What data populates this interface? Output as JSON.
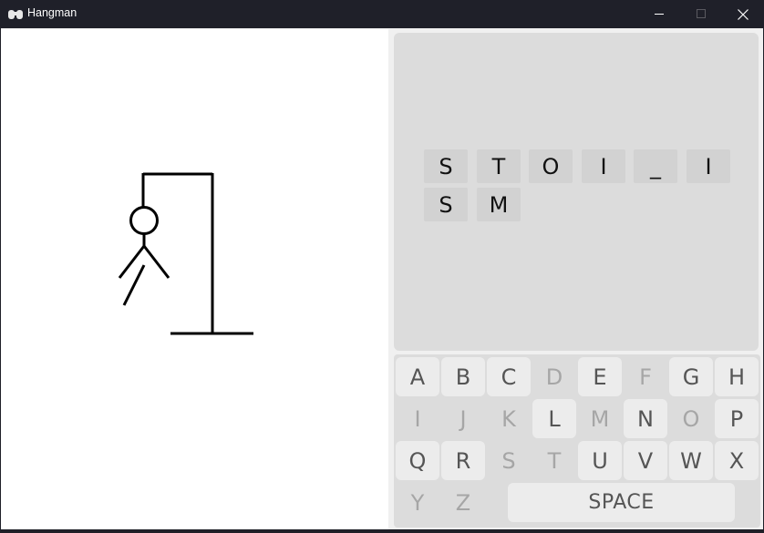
{
  "window": {
    "title": "Hangman",
    "minimize_icon": "minimize-icon",
    "maximize_icon": "maximize-icon",
    "close_icon": "close-icon"
  },
  "word": {
    "tiles": [
      "S",
      "T",
      "O",
      "I",
      "_",
      "I",
      "S",
      "M"
    ]
  },
  "keyboard": {
    "keys": [
      {
        "label": "A",
        "used": false
      },
      {
        "label": "B",
        "used": false
      },
      {
        "label": "C",
        "used": false
      },
      {
        "label": "D",
        "used": true
      },
      {
        "label": "E",
        "used": false
      },
      {
        "label": "F",
        "used": true
      },
      {
        "label": "G",
        "used": false
      },
      {
        "label": "H",
        "used": false
      },
      {
        "label": "I",
        "used": true
      },
      {
        "label": "J",
        "used": true
      },
      {
        "label": "K",
        "used": true
      },
      {
        "label": "L",
        "used": false
      },
      {
        "label": "M",
        "used": true
      },
      {
        "label": "N",
        "used": false
      },
      {
        "label": "O",
        "used": true
      },
      {
        "label": "P",
        "used": false
      },
      {
        "label": "Q",
        "used": false
      },
      {
        "label": "R",
        "used": false
      },
      {
        "label": "S",
        "used": true
      },
      {
        "label": "T",
        "used": true
      },
      {
        "label": "U",
        "used": false
      },
      {
        "label": "V",
        "used": false
      },
      {
        "label": "W",
        "used": false
      },
      {
        "label": "X",
        "used": false
      },
      {
        "label": "Y",
        "used": true
      },
      {
        "label": "Z",
        "used": true
      }
    ],
    "space_label": "SPACE"
  },
  "colors": {
    "titlebar": "#1f2029",
    "panel": "#dcdcdc",
    "tile": "#d2d2d2",
    "key_active": "#ececec",
    "key_used_text": "#a6a6a6"
  }
}
